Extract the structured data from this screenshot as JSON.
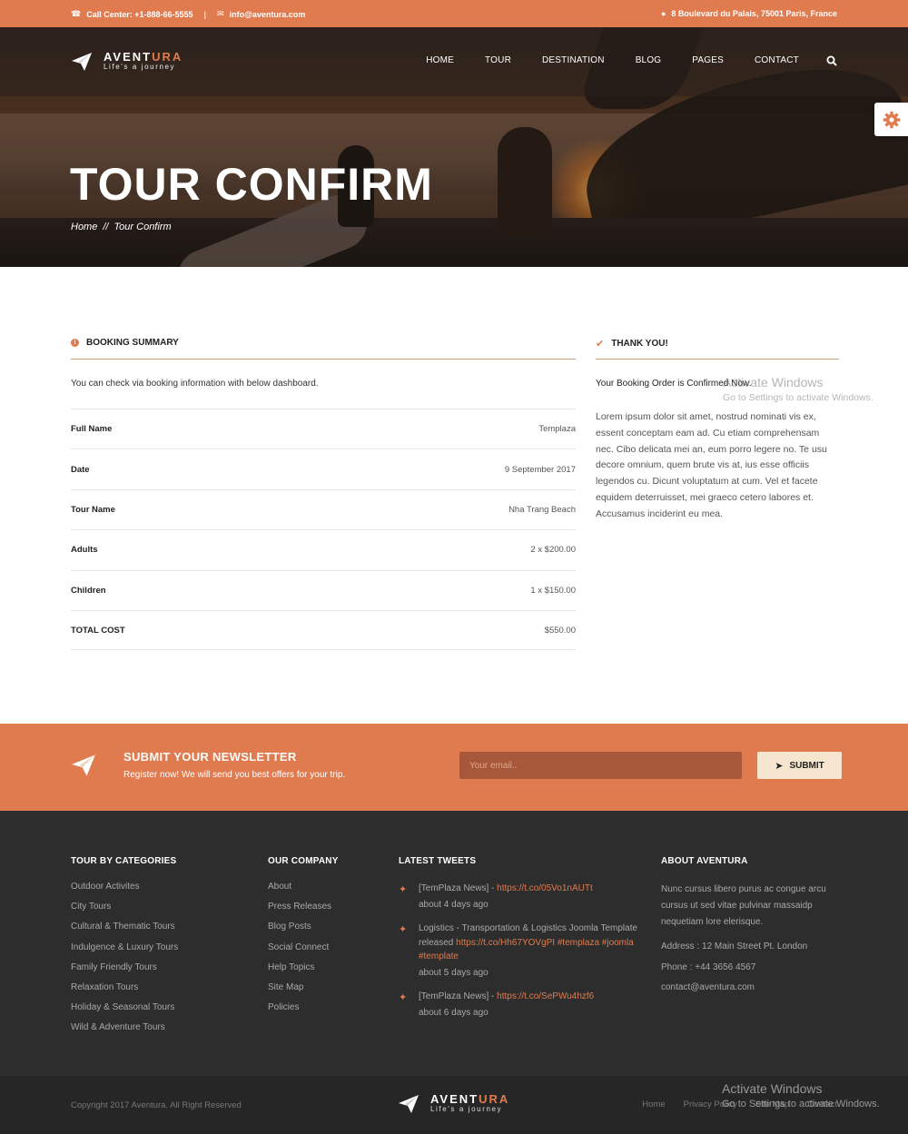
{
  "topbar": {
    "phone": "Call Center: +1-888-66-5555",
    "email": "info@aventura.com",
    "address": "8 Boulevard du Palais, 75001 Paris, France"
  },
  "brand": {
    "name_main": "AVENT",
    "name_accent": "URA",
    "tagline": "Life's a journey"
  },
  "nav": {
    "items": [
      "HOME",
      "TOUR",
      "DESTINATION",
      "BLOG",
      "PAGES",
      "CONTACT"
    ]
  },
  "hero": {
    "title": "TOUR CONFIRM",
    "breadcrumb": {
      "home": "Home",
      "sep": "//",
      "current": "Tour Confirm"
    }
  },
  "booking": {
    "heading": "BOOKING SUMMARY",
    "description": "You can check via booking information with below dashboard.",
    "rows": [
      {
        "label": "Full Name",
        "value": "Templaza"
      },
      {
        "label": "Date",
        "value": "9 September 2017"
      },
      {
        "label": "Tour Name",
        "value": "Nha Trang Beach"
      },
      {
        "label": "Adults",
        "value": "2 x $200.00"
      },
      {
        "label": "Children",
        "value": "1 x $150.00"
      },
      {
        "label": "TOTAL COST",
        "value": "$550.00"
      }
    ]
  },
  "thanks": {
    "heading": "THANK YOU!",
    "confirm": "Your Booking Order is Confirmed Now.",
    "text": "Lorem ipsum dolor sit amet, nostrud nominati vis ex, essent conceptam eam ad. Cu etiam comprehensam nec. Cibo delicata mei an, eum porro legere no. Te usu decore omnium, quem brute vis at, ius esse officiis legendos cu. Dicunt voluptatum at cum. Vel et facete equidem deterruisset, mei graeco cetero labores et. Accusamus inciderint eu mea."
  },
  "watermark": {
    "title": "Activate Windows",
    "sub": "Go to Settings to activate Windows."
  },
  "newsletter": {
    "title": "SUBMIT YOUR NEWSLETTER",
    "subtitle": "Register now! We will send you best offers for your trip.",
    "placeholder": "Your email..",
    "button": "SUBMIT"
  },
  "footer": {
    "categories": {
      "title": "TOUR BY CATEGORIES",
      "items": [
        "Outdoor Activites",
        "City Tours",
        "Cultural & Thematic Tours",
        "Indulgence & Luxury Tours",
        "Family Friendly Tours",
        "Relaxation Tours",
        "Holiday & Seasonal Tours",
        "Wild & Adventure Tours"
      ]
    },
    "company": {
      "title": "OUR COMPANY",
      "items": [
        "About",
        "Press Releases",
        "Blog Posts",
        "Social Connect",
        "Help Topics",
        "Site Map",
        "Policies"
      ]
    },
    "tweets": {
      "title": "LATEST TWEETS",
      "items": [
        {
          "prefix": "[TemPlaza News] - ",
          "link": "https://t.co/05Vo1nAUTt",
          "ago": "about 4 days ago"
        },
        {
          "prefix": "Logistics - Transportation & Logistics Joomla Template released ",
          "link": "https://t.co/Hh67YOVgPI #templaza #joomla #template",
          "ago": "about 5 days ago"
        },
        {
          "prefix": "[TemPlaza News] - ",
          "link": "https://t.co/SePWu4hzf6",
          "ago": "about 6 days ago"
        }
      ]
    },
    "about": {
      "title": "ABOUT AVENTURA",
      "text": "Nunc cursus libero purus ac congue arcu cursus ut sed vitae pulvinar massaidp nequetiam lore elerisque.",
      "address": "Address : 12 Main Street Pt. London",
      "phone": "Phone : +44 3656 4567",
      "email": "contact@aventura.com"
    }
  },
  "bottom": {
    "copyright": "Copyright 2017 Aventura. All Right Reserved",
    "links": [
      "Home",
      "Privacy Policy",
      "Site Map",
      "Contact"
    ]
  },
  "colors": {
    "accent": "#e07b4f",
    "footer_bg": "#2d2d2d",
    "bottom_bg": "#262626",
    "button_bg": "#f6e6cf"
  }
}
